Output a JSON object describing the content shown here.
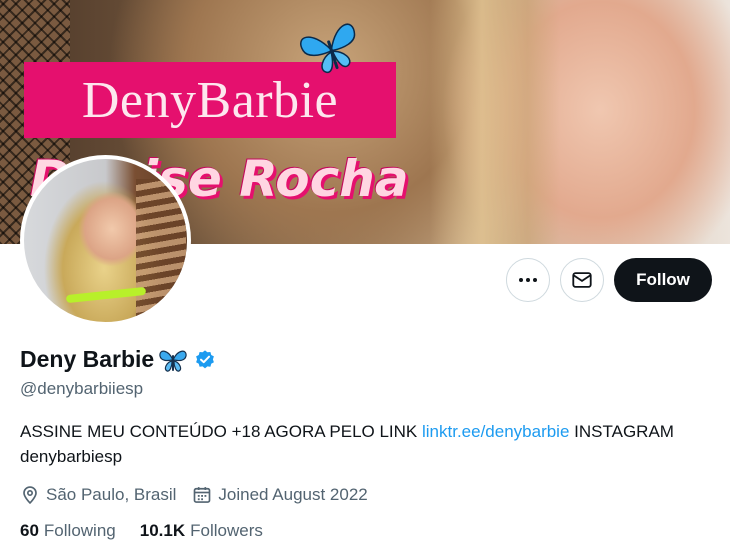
{
  "banner": {
    "logo_text": "DenyBarbie",
    "script_text": "Denise Rocha"
  },
  "actions": {
    "more_icon": "more-horizontal-icon",
    "message_icon": "envelope-icon",
    "follow_label": "Follow"
  },
  "profile": {
    "display_name": "Deny Barbie",
    "name_emoji": "butterfly-emoji",
    "verified_icon": "verified-badge-icon",
    "handle": "@denybarbiiesp",
    "bio_before": "ASSINE MEU CONTEÚDO +18 AGORA PELO LINK ",
    "bio_link": "linktr.ee/denybarbie",
    "bio_after": " INSTAGRAM denybarbiesp",
    "location": "São Paulo, Brasil",
    "location_icon": "map-pin-icon",
    "joined": "Joined August 2022",
    "joined_icon": "calendar-icon"
  },
  "stats": {
    "following_count": "60",
    "following_label": "Following",
    "followers_count": "10.1K",
    "followers_label": "Followers"
  },
  "colors": {
    "accent_link": "#1d9bf0",
    "verified_blue": "#1d9bf0",
    "brand_pink": "#e5106e",
    "follow_button_bg": "#0f1419",
    "secondary_text": "#536471"
  }
}
